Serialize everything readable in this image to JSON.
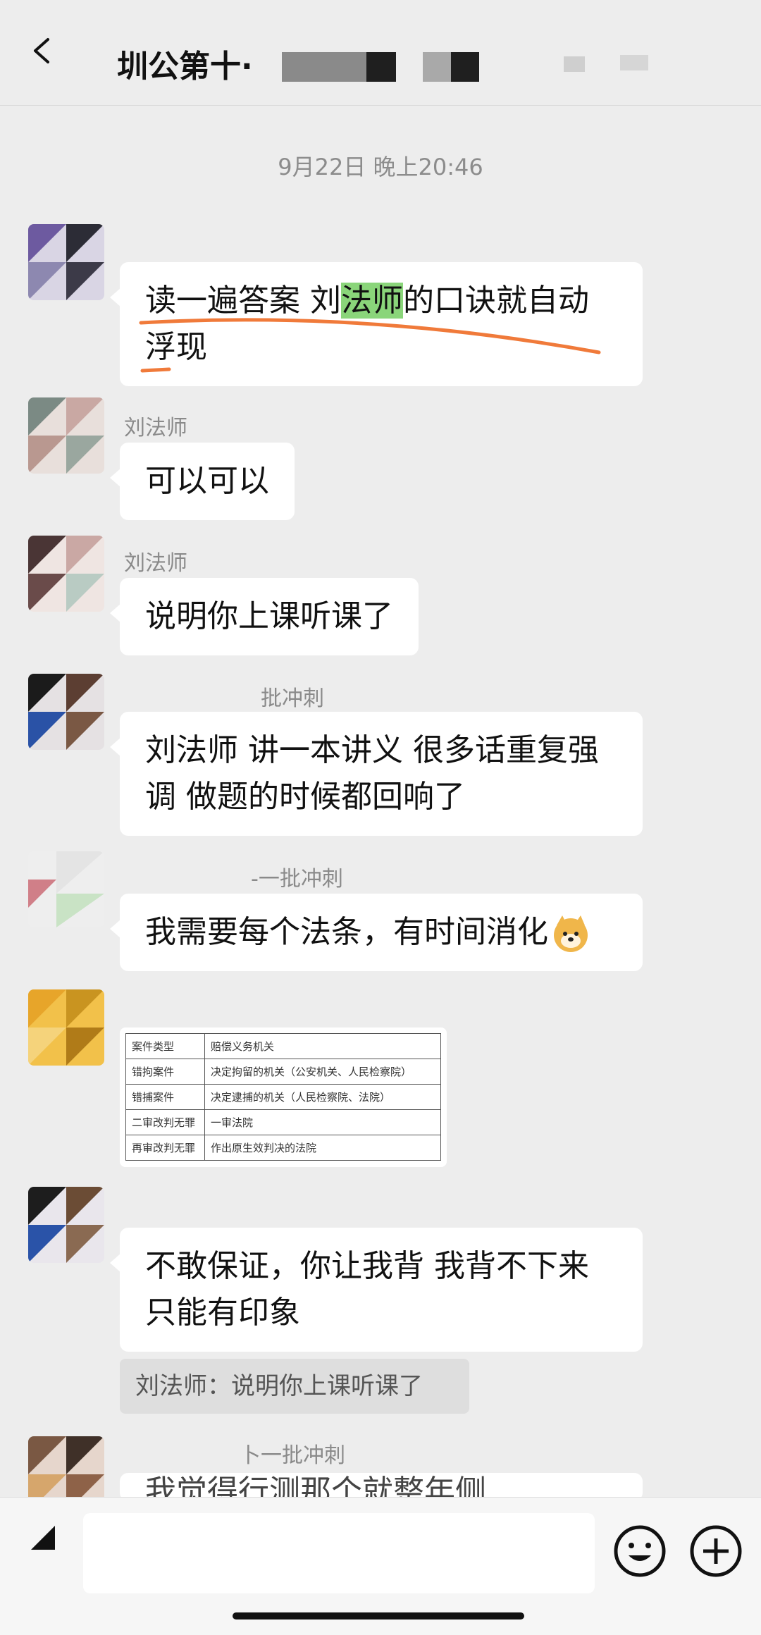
{
  "header": {
    "title": "圳公第十·",
    "back_icon": "back-arrow-icon"
  },
  "timestamp": "9月22日 晚上20:46",
  "messages": [
    {
      "type": "text",
      "sender": "",
      "lines": [
        "读一遍答案 刘法师的口诀就自动",
        "浮现"
      ],
      "highlight": "法师"
    },
    {
      "type": "text",
      "sender": "刘法师",
      "lines": [
        "可以可以"
      ]
    },
    {
      "type": "text",
      "sender": "刘法师",
      "lines": [
        "说明你上课听课了"
      ]
    },
    {
      "type": "text",
      "sender": "批冲刺",
      "lines": [
        "刘法师 讲一本讲义 很多话重复强",
        "调 做题的时候都回响了"
      ]
    },
    {
      "type": "text",
      "sender": "-一批冲刺",
      "lines": [
        "我需要每个法条，有时间消化"
      ],
      "emoji": "doge-emoji-icon"
    },
    {
      "type": "image-table",
      "sender": "",
      "table": [
        [
          "案件类型",
          "赔偿义务机关"
        ],
        [
          "错拘案件",
          "决定拘留的机关（公安机关、人民检察院）"
        ],
        [
          "错捕案件",
          "决定逮捕的机关（人民检察院、法院）"
        ],
        [
          "二审改判无罪",
          "一审法院"
        ],
        [
          "再审改判无罪",
          "作出原生效判决的法院"
        ]
      ]
    },
    {
      "type": "text",
      "sender": "",
      "lines": [
        "不敢保证，你让我背 我背不下来",
        "只能有印象"
      ],
      "quote": "刘法师：说明你上课听课了"
    },
    {
      "type": "text-partial",
      "sender": "卜一批冲刺",
      "lines": [
        "我觉得行测那个就整年侧 ..."
      ]
    }
  ],
  "input": {
    "placeholder": "",
    "voice_icon": "voice-toggle-icon",
    "emoji_icon": "emoji-icon",
    "plus_icon": "plus-icon"
  },
  "colors": {
    "background": "#ededed",
    "bubble": "#ffffff",
    "highlight": "#8ad57a",
    "annotation": "#f07a3a"
  }
}
